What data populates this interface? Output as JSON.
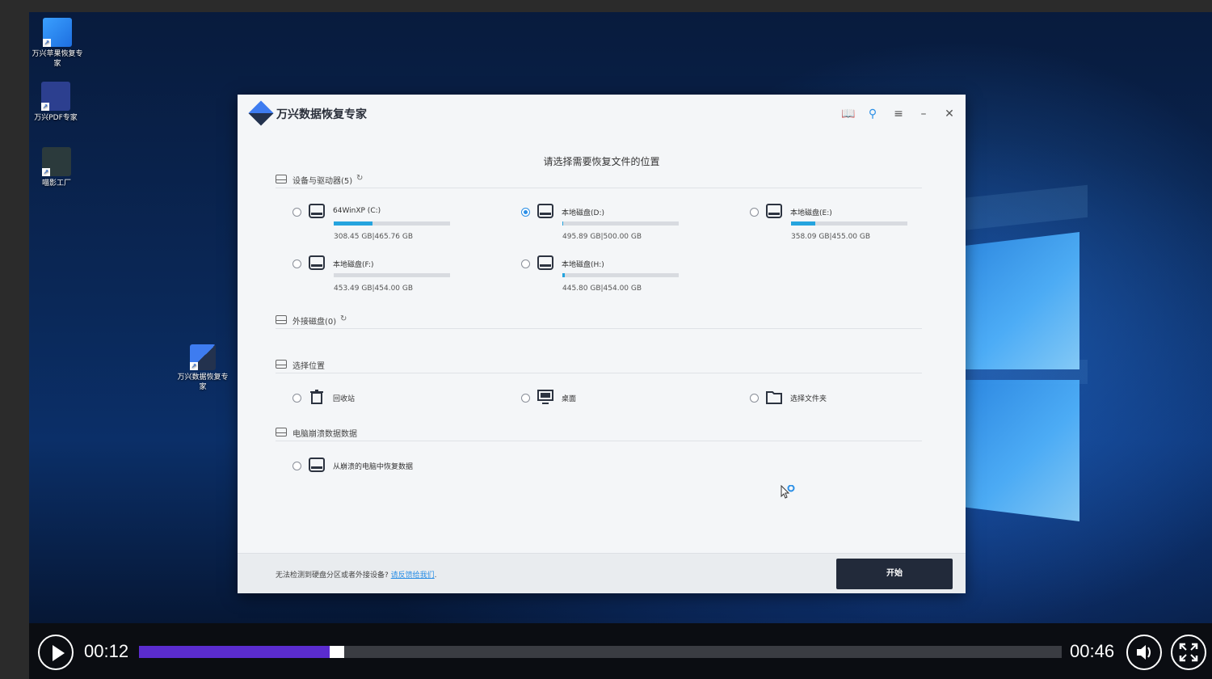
{
  "desktop": {
    "icons": [
      {
        "label": "万兴苹果恢复专家",
        "icon": "apple-recovery-app-icon"
      },
      {
        "label": "万兴PDF专家",
        "icon": "pdf-app-icon"
      },
      {
        "label": "喵影工厂",
        "icon": "video-editor-app-icon"
      },
      {
        "label": "万兴数据恢复专家",
        "icon": "data-recovery-app-icon"
      }
    ]
  },
  "app": {
    "title": "万兴数据恢复专家",
    "toolbar": {
      "guide_icon": "book-icon",
      "register_icon": "key-icon",
      "menu_icon": "menu-icon",
      "minimize_icon": "minimize-icon",
      "close_icon": "close-icon"
    },
    "heading": "请选择需要恢复文件的位置",
    "sections": {
      "devices": "设备与驱动器(5)",
      "external": "外接磁盘(0)",
      "location": "选择位置",
      "crash": "电脑崩溃数据数据"
    },
    "drives": [
      {
        "name": "64WinXP (C:)",
        "size": "308.45  GB|465.76  GB",
        "used_fraction": 0.33,
        "selected": false
      },
      {
        "name": "本地磁盘(D:)",
        "size": "495.89  GB|500.00  GB",
        "used_fraction": 0.01,
        "selected": true
      },
      {
        "name": "本地磁盘(E:)",
        "size": "358.09  GB|455.00  GB",
        "used_fraction": 0.21,
        "selected": false
      },
      {
        "name": "本地磁盘(F:)",
        "size": "453.49  GB|454.00  GB",
        "used_fraction": 0.0,
        "selected": false
      },
      {
        "name": "本地磁盘(H:)",
        "size": "445.80  GB|454.00  GB",
        "used_fraction": 0.02,
        "selected": false
      }
    ],
    "locations": [
      {
        "label": "回收站",
        "icon": "recycle-bin-icon"
      },
      {
        "label": "桌面",
        "icon": "desktop-icon"
      },
      {
        "label": "选择文件夹",
        "icon": "folder-icon"
      }
    ],
    "crash_option": {
      "label": "从崩溃的电脑中恢复数据",
      "icon": "disk-icon"
    },
    "footer": {
      "text": "无法检测到硬盘分区或者外接设备?",
      "link": "请反馈给我们",
      "link_suffix": ".",
      "start_button": "开始"
    },
    "colors": {
      "accent": "#2b8fe6",
      "bar_fill": "#25a4de",
      "start_button_bg": "#222a3a"
    }
  },
  "player": {
    "current_time": "00:12",
    "total_time": "00:46",
    "progress_fraction": 0.26,
    "play_icon": "play-icon",
    "volume_icon": "volume-icon",
    "fullscreen_icon": "fullscreen-icon",
    "colors": {
      "progress": "#5b2ccf"
    }
  }
}
